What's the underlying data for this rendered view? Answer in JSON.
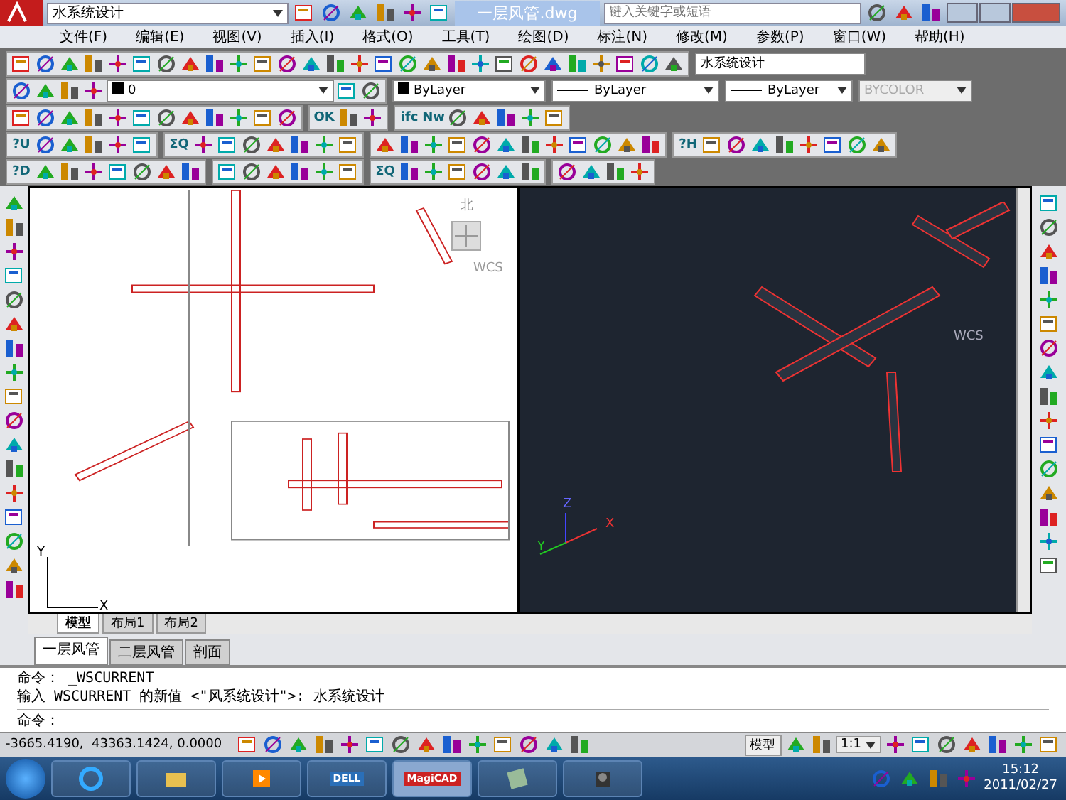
{
  "title_bar": {
    "workspace": "水系统设计",
    "document_title": "一层风管.dwg",
    "search": {
      "placeholder": "键入关键字或短语"
    }
  },
  "menu": [
    "文件(F)",
    "编辑(E)",
    "视图(V)",
    "插入(I)",
    "格式(O)",
    "工具(T)",
    "绘图(D)",
    "标注(N)",
    "修改(M)",
    "参数(P)",
    "窗口(W)",
    "帮助(H)"
  ],
  "standard_toolbar": {
    "workspace_dropdown": "水系统设计"
  },
  "properties_bar": {
    "layer": "0",
    "color_setting": "ByLayer",
    "linetype": "ByLayer",
    "lineweight": "ByLayer",
    "plot_style": "BYCOLOR",
    "plot_style_disabled": true
  },
  "tool_rows": [
    {
      "labels": [
        "OK",
        "ifc",
        "Nw"
      ]
    },
    {
      "labels": [
        "?U",
        "ΣQ",
        "?H"
      ]
    },
    {
      "labels": [
        "?D",
        "ΣQ"
      ]
    }
  ],
  "viewport": {
    "compass_label": "北",
    "wcs_labels": [
      "WCS",
      "WCS"
    ],
    "ucs_axes": [
      "Y",
      "X"
    ],
    "axes_3d": [
      "Z",
      "Y",
      "X"
    ]
  },
  "layout_tabs": [
    {
      "label": "模型",
      "selected": true
    },
    {
      "label": "布局1",
      "selected": false
    },
    {
      "label": "布局2",
      "selected": false
    }
  ],
  "sheet_tabs": [
    {
      "label": "一层风管",
      "selected": true
    },
    {
      "label": "二层风管",
      "selected": false
    },
    {
      "label": "剖面",
      "selected": false
    }
  ],
  "command": {
    "history": [
      "命令： _WSCURRENT",
      "输入 WSCURRENT 的新值 <\"风系统设计\">: 水系统设计"
    ],
    "prompt": "命令："
  },
  "status_bar": {
    "coordinates": "-3665.4190,  43363.1424, 0.0000",
    "space": "模型",
    "scale": "1:1"
  },
  "taskbar": {
    "apps": [
      {
        "kind": "browser",
        "selected": false
      },
      {
        "kind": "folder",
        "selected": false
      },
      {
        "kind": "media",
        "selected": false
      },
      {
        "kind": "dell",
        "label": "DELL",
        "selected": false
      },
      {
        "kind": "magicad",
        "label": "MagiCAD",
        "selected": true
      },
      {
        "kind": "notes",
        "selected": false
      },
      {
        "kind": "camera",
        "selected": false
      }
    ],
    "time": "15:12",
    "date": "2011/02/27"
  }
}
